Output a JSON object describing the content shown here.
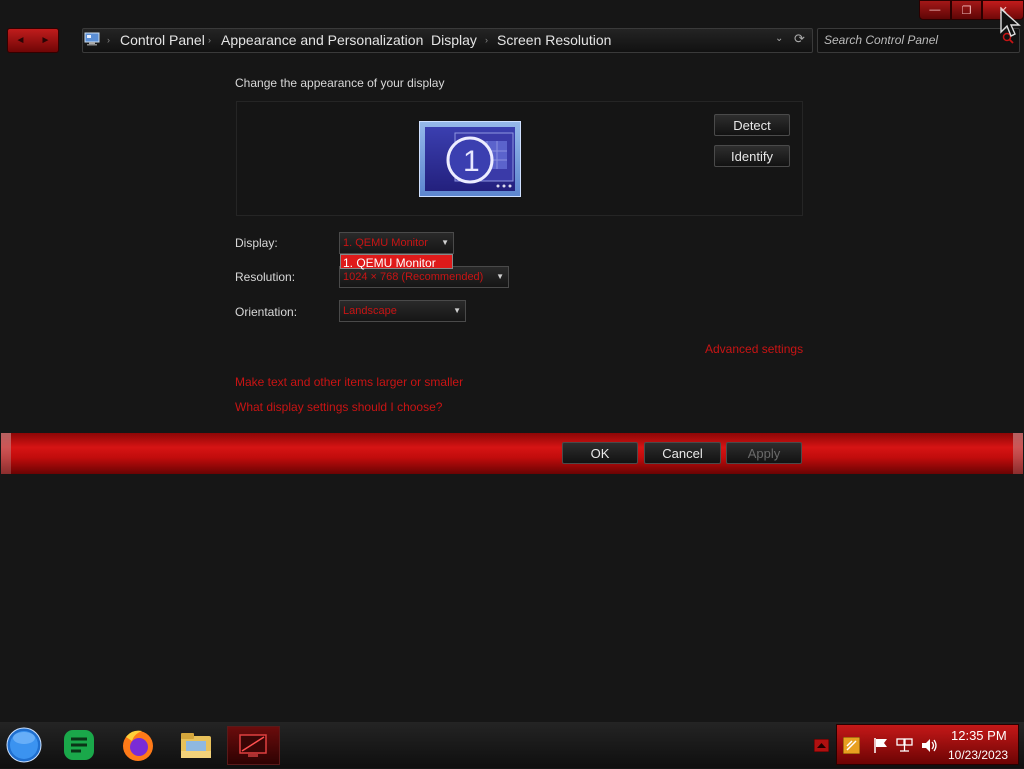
{
  "window_controls": {
    "minimize": "—",
    "maximize": "❐",
    "close": "✕"
  },
  "nav": {
    "back": "◄",
    "forward": "►"
  },
  "breadcrumb": {
    "items": [
      "Control Panel",
      "Appearance and Personalization",
      "Display",
      "Screen Resolution"
    ],
    "separator": "›",
    "dropdown": "⌄",
    "refresh": "⟳"
  },
  "search": {
    "placeholder": "Search Control Panel"
  },
  "page": {
    "heading": "Change the appearance of your display"
  },
  "monitor_panel": {
    "monitor_number": "1",
    "detect_label": "Detect",
    "identify_label": "Identify"
  },
  "settings": {
    "display_label": "Display:",
    "display_value": "1. QEMU Monitor",
    "display_options": [
      "1. QEMU Monitor"
    ],
    "resolution_label": "Resolution:",
    "resolution_value": "1024 × 768 (Recommended)",
    "orientation_label": "Orientation:",
    "orientation_value": "Landscape",
    "dropdown_arrow": "▼"
  },
  "links": {
    "advanced": "Advanced settings",
    "larger_text": "Make text and other items larger or smaller",
    "which_settings": "What display settings should I choose?"
  },
  "buttons": {
    "ok": "OK",
    "cancel": "Cancel",
    "apply": "Apply"
  },
  "tray": {
    "time": "12:35 PM",
    "date": "10/23/2023"
  },
  "colors": {
    "accent_red": "#c81414",
    "background": "#161616",
    "highlight": "#df1a1a"
  }
}
